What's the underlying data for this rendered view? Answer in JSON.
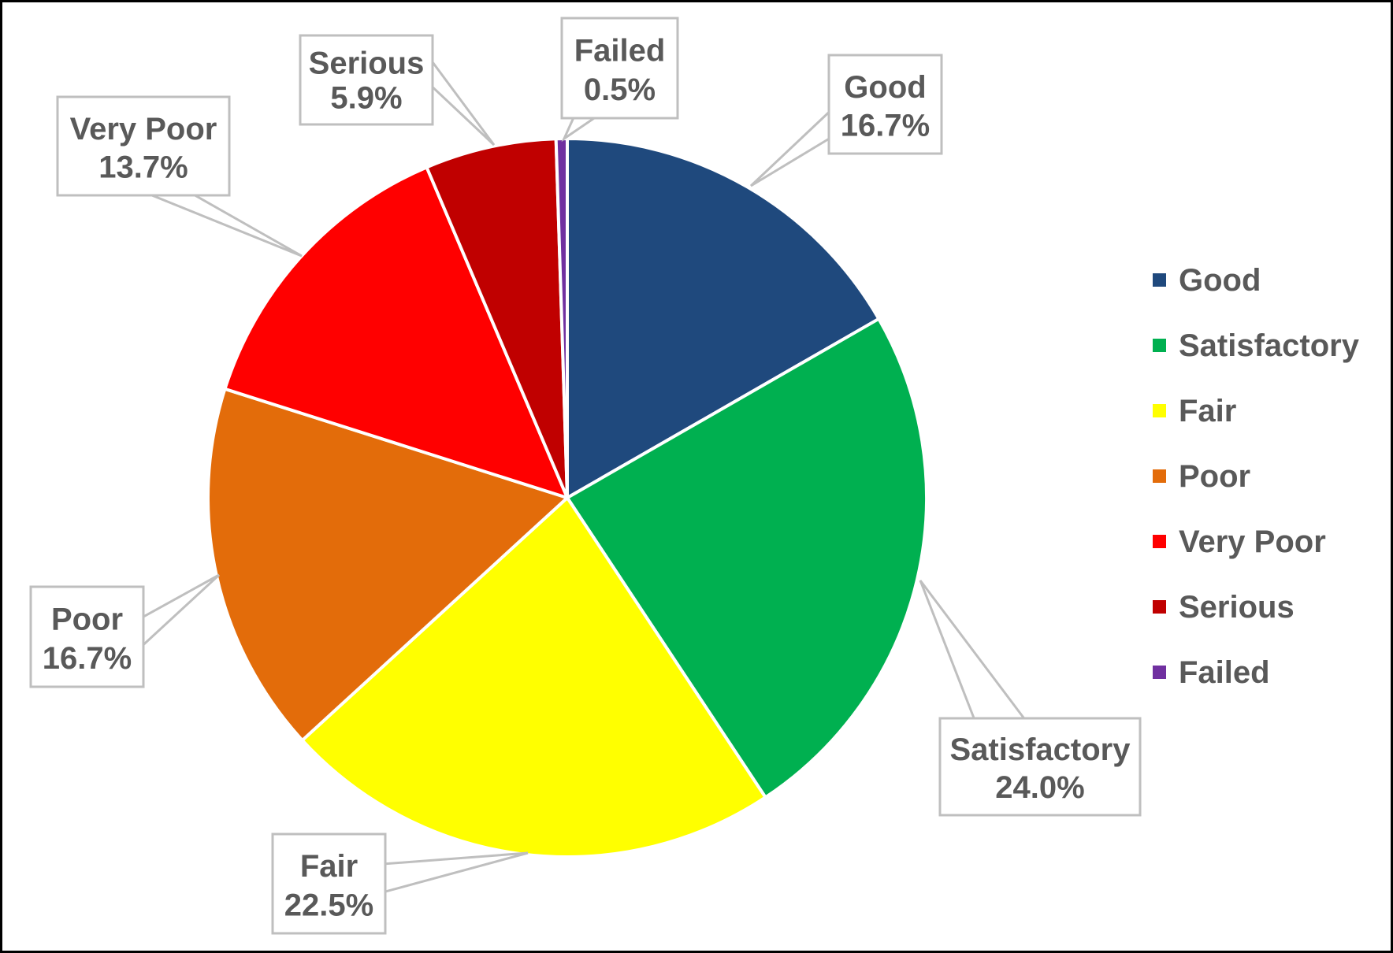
{
  "chart_data": {
    "type": "pie",
    "title": "",
    "categories": [
      "Good",
      "Satisfactory",
      "Fair",
      "Poor",
      "Very Poor",
      "Serious",
      "Failed"
    ],
    "values": [
      16.7,
      24.0,
      22.5,
      16.7,
      13.7,
      5.9,
      0.5
    ],
    "unit": "%",
    "data_labels": [
      "16.7%",
      "24.0%",
      "22.5%",
      "16.7%",
      "13.7%",
      "5.9%",
      "0.5%"
    ],
    "colors": [
      "#1F497D",
      "#00B050",
      "#FFFF00",
      "#E36C0A",
      "#FF0000",
      "#C00000",
      "#7030A0"
    ],
    "start_angle": "12 o'clock",
    "direction": "clockwise",
    "legend": {
      "position": "right",
      "entries": [
        "Good",
        "Satisfactory",
        "Fair",
        "Poor",
        "Very Poor",
        "Serious",
        "Failed"
      ]
    }
  }
}
